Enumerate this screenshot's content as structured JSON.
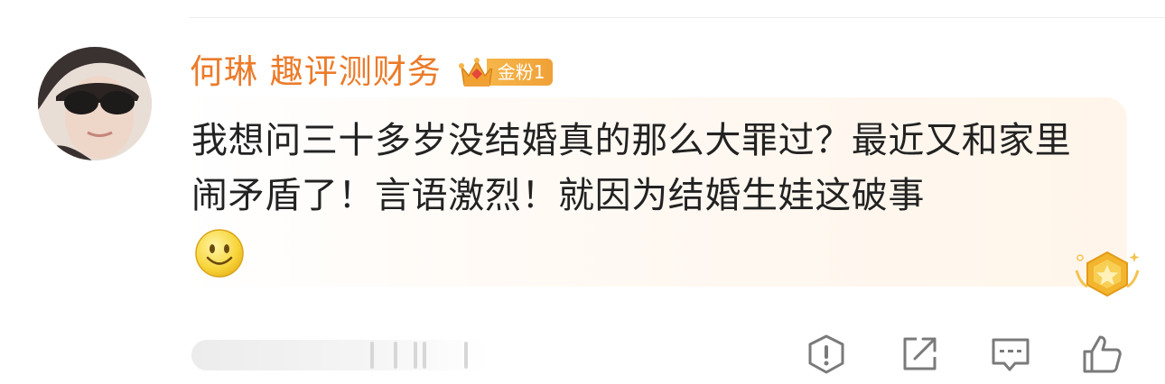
{
  "comment": {
    "author": "何琳 趣评测财务",
    "fan_badge": "金粉1",
    "text": "我想问三十多岁没结婚真的那么大罪过？最近又和家里闹矛盾了！言语激烈！就因为结婚生娃这破事"
  },
  "icons": {
    "avatar": "avatar",
    "crown": "crown-icon",
    "emoji": "smile-emoji-icon",
    "medal": "star-medal-icon",
    "report": "report-icon",
    "share": "share-icon",
    "reply": "comment-icon",
    "like": "thumbs-up-icon"
  },
  "colors": {
    "name": "#eb7b2a",
    "badge": "#f2a93b",
    "text": "#222222",
    "icon": "#7a7a7a"
  }
}
